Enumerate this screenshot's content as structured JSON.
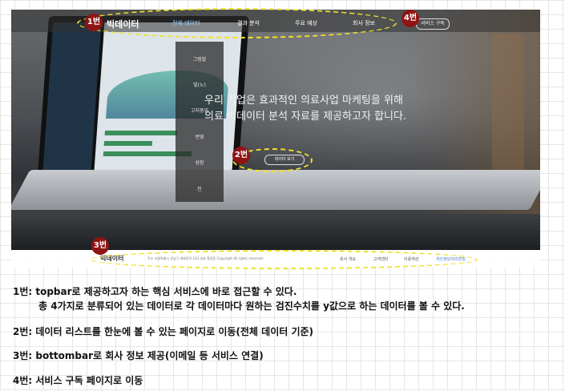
{
  "topbar": {
    "logo": "빅데이터",
    "items": [
      "전체 데이터",
      "결과 분석",
      "주요 예상",
      "회사 정보",
      "서비스 구독"
    ]
  },
  "dropdown": {
    "items": [
      "그림말",
      "빛(노)",
      "고지중위",
      "번영",
      "성장",
      "인"
    ]
  },
  "hero": {
    "line1": "우리 기업은 효과적인 의료사업 마케팅을 위해",
    "line2": "의료 빅데이터 분석 자료를 제공하고자 합니다.",
    "cta": "데이터 보기"
  },
  "bottombar": {
    "logo": "빅데이터",
    "info": "주소 서울특별시 강남구 테헤란로 123 대표 홍길동 Copyright All rights reserved.",
    "links": [
      "회사 개요",
      "고객센터",
      "이용약관",
      "개인정보처리방침"
    ]
  },
  "markers": {
    "m1": "1번",
    "m2": "2번",
    "m3": "3번",
    "m4": "4번"
  },
  "notes": {
    "n1a": "1번: topbar로 제공하고자 하는 핵심 서비스에 바로 접근할 수 있다.",
    "n1b": "총 4가지로 분류되어 있는 데이터로 각 데이터마다 원하는 검진수치를 y값으로 하는 데이터를 볼 수 있다.",
    "n2": "2번: 데이터 리스트를 한눈에 볼 수 있는 페이지로 이동(전체 데이터 기준)",
    "n3": "3번: bottombar로 회사 정보 제공(이메일 등 서비스 연결)",
    "n4": "4번: 서비스 구독 페이지로 이동"
  },
  "colors": {
    "marker": "#8f1414",
    "highlight": "#f2e12b"
  }
}
